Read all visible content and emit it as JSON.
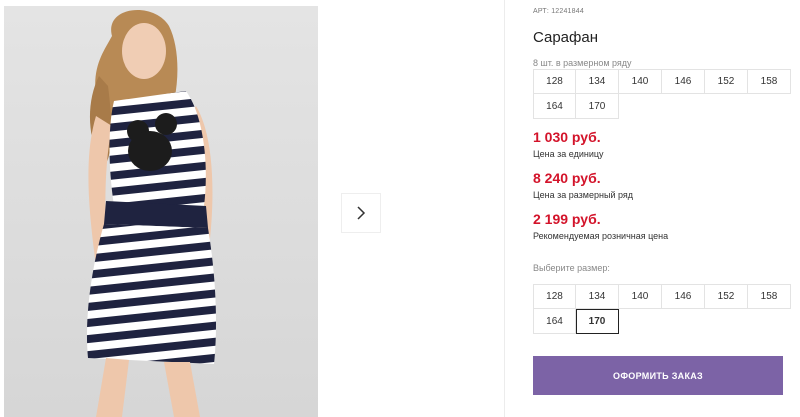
{
  "product": {
    "sku": "АРТ: 12241844",
    "title": "Сарафан"
  },
  "pack": {
    "note": "8 шт. в размерном ряду",
    "sizes": [
      "128",
      "134",
      "140",
      "146",
      "152",
      "158",
      "164",
      "170"
    ]
  },
  "prices": {
    "unit": {
      "value": "1 030 руб.",
      "label": "Цена за единицу"
    },
    "pack": {
      "value": "8 240 руб.",
      "label": "Цена за размерный ряд"
    },
    "retail": {
      "value": "2 199 руб.",
      "label": "Рекомендуемая розничная цена"
    }
  },
  "size_picker": {
    "label": "Выберите размер:",
    "sizes": [
      "128",
      "134",
      "140",
      "146",
      "152",
      "158",
      "164",
      "170"
    ],
    "selected": "170"
  },
  "order": {
    "button_label": "ОФОРМИТЬ ЗАКАЗ"
  },
  "icons": {
    "gallery_next": "chevron-right-icon"
  },
  "colors": {
    "price": "#d3132a",
    "accent_button": "#7c63a6"
  }
}
